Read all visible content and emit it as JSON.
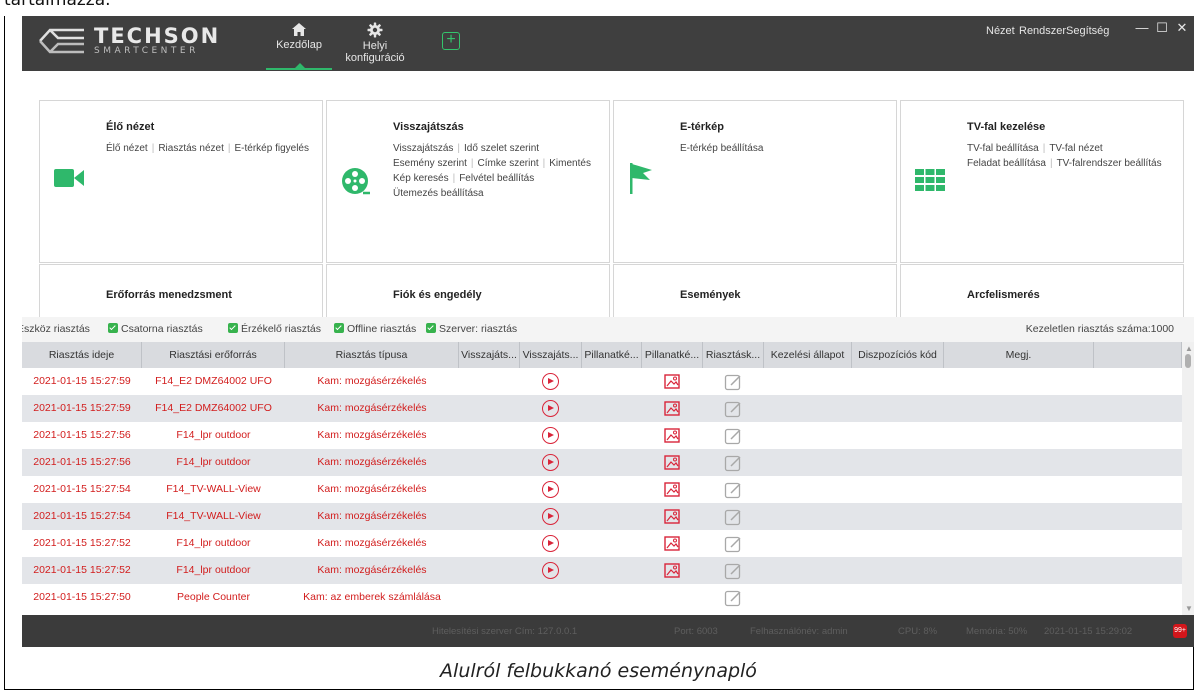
{
  "page_caption_top": "tartalmazza.",
  "titlebar": {
    "brand": "TECHSON",
    "brand_sub": "SMARTCENTER",
    "nav_home": "Kezdőlap",
    "nav_local_config": "Helyi konfiguráció",
    "menu_view": "Nézet",
    "menu_system": "Rendszer",
    "menu_help": "Segítség",
    "minimize": "—",
    "maximize": "☐",
    "close": "✕"
  },
  "cards": [
    {
      "title": "Élő nézet",
      "lines": [
        [
          "Élő nézet",
          "Riasztás nézet",
          "E-térkép figyelés"
        ]
      ]
    },
    {
      "title": "Visszajátszás",
      "lines": [
        [
          "Visszajátszás",
          "Idő szelet szerint"
        ],
        [
          "Esemény szerint",
          "Címke szerint",
          "Kimentés"
        ],
        [
          "Kép keresés",
          "Felvétel beállítás"
        ],
        [
          "Ütemezés beállítása"
        ]
      ]
    },
    {
      "title": "E-térkép",
      "lines": [
        [
          "E-térkép beállítása"
        ]
      ]
    },
    {
      "title": "TV-fal kezelése",
      "lines": [
        [
          "TV-fal beállítása",
          "TV-fal nézet"
        ],
        [
          "Feladat beállítása",
          "TV-falrendszer beállítás"
        ]
      ]
    },
    {
      "title": "Erőforrás menedzsment",
      "lines": []
    },
    {
      "title": "Fiók és engedély",
      "lines": []
    },
    {
      "title": "Események",
      "lines": []
    },
    {
      "title": "Arcfelismerés",
      "lines": []
    }
  ],
  "filters": [
    "Eszköz riasztás",
    "Csatorna riasztás",
    "Érzékelő riasztás",
    "Offline riasztás",
    "Szerver: riasztás"
  ],
  "unhandled_count": "Kezeletlen riasztás száma:1000",
  "table": {
    "columns": [
      "Riasztás ideje",
      "Riasztási erőforrás",
      "Riasztás típusa",
      "Visszajáts...",
      "Visszajáts...",
      "Pillanatké...",
      "Pillanatké...",
      "Riasztásk...",
      "Kezelési állapot",
      "Diszpozíciós kód",
      "Megj.",
      ""
    ],
    "rows": [
      {
        "time": "2021-01-15 15:27:59",
        "source": "F14_E2 DMZ64002 UFO",
        "type": "Kam: mozgásérzékelés",
        "playback": true,
        "snapshot": true,
        "handle": true
      },
      {
        "time": "2021-01-15 15:27:59",
        "source": "F14_E2 DMZ64002 UFO",
        "type": "Kam: mozgásérzékelés",
        "playback": true,
        "snapshot": true,
        "handle": true
      },
      {
        "time": "2021-01-15 15:27:56",
        "source": "F14_lpr outdoor",
        "type": "Kam: mozgásérzékelés",
        "playback": true,
        "snapshot": true,
        "handle": true
      },
      {
        "time": "2021-01-15 15:27:56",
        "source": "F14_lpr outdoor",
        "type": "Kam: mozgásérzékelés",
        "playback": true,
        "snapshot": true,
        "handle": true
      },
      {
        "time": "2021-01-15 15:27:54",
        "source": "F14_TV-WALL-View",
        "type": "Kam: mozgásérzékelés",
        "playback": true,
        "snapshot": true,
        "handle": true
      },
      {
        "time": "2021-01-15 15:27:54",
        "source": "F14_TV-WALL-View",
        "type": "Kam: mozgásérzékelés",
        "playback": true,
        "snapshot": true,
        "handle": true
      },
      {
        "time": "2021-01-15 15:27:52",
        "source": "F14_lpr outdoor",
        "type": "Kam: mozgásérzékelés",
        "playback": true,
        "snapshot": true,
        "handle": true
      },
      {
        "time": "2021-01-15 15:27:52",
        "source": "F14_lpr outdoor",
        "type": "Kam: mozgásérzékelés",
        "playback": true,
        "snapshot": true,
        "handle": true
      },
      {
        "time": "2021-01-15 15:27:50",
        "source": "People Counter",
        "type": "Kam: az emberek számlálása",
        "playback": false,
        "snapshot": false,
        "handle": true
      }
    ]
  },
  "statusbar": {
    "server": "Hitelesítési szerver Cím: 127.0.0.1",
    "port": "Port: 6003",
    "user": "Felhasználónév: admin",
    "cpu": "CPU: 8%",
    "memory": "Memória: 50%",
    "datetime": "2021-01-15 15:29:02",
    "alarm_badge": "99+"
  },
  "caption": "Alulról felbukkanó eseménynapló",
  "colors": {
    "accent": "#2fb86b",
    "alarm_red": "#d21d1d",
    "titlebar": "#3f3f3f"
  }
}
